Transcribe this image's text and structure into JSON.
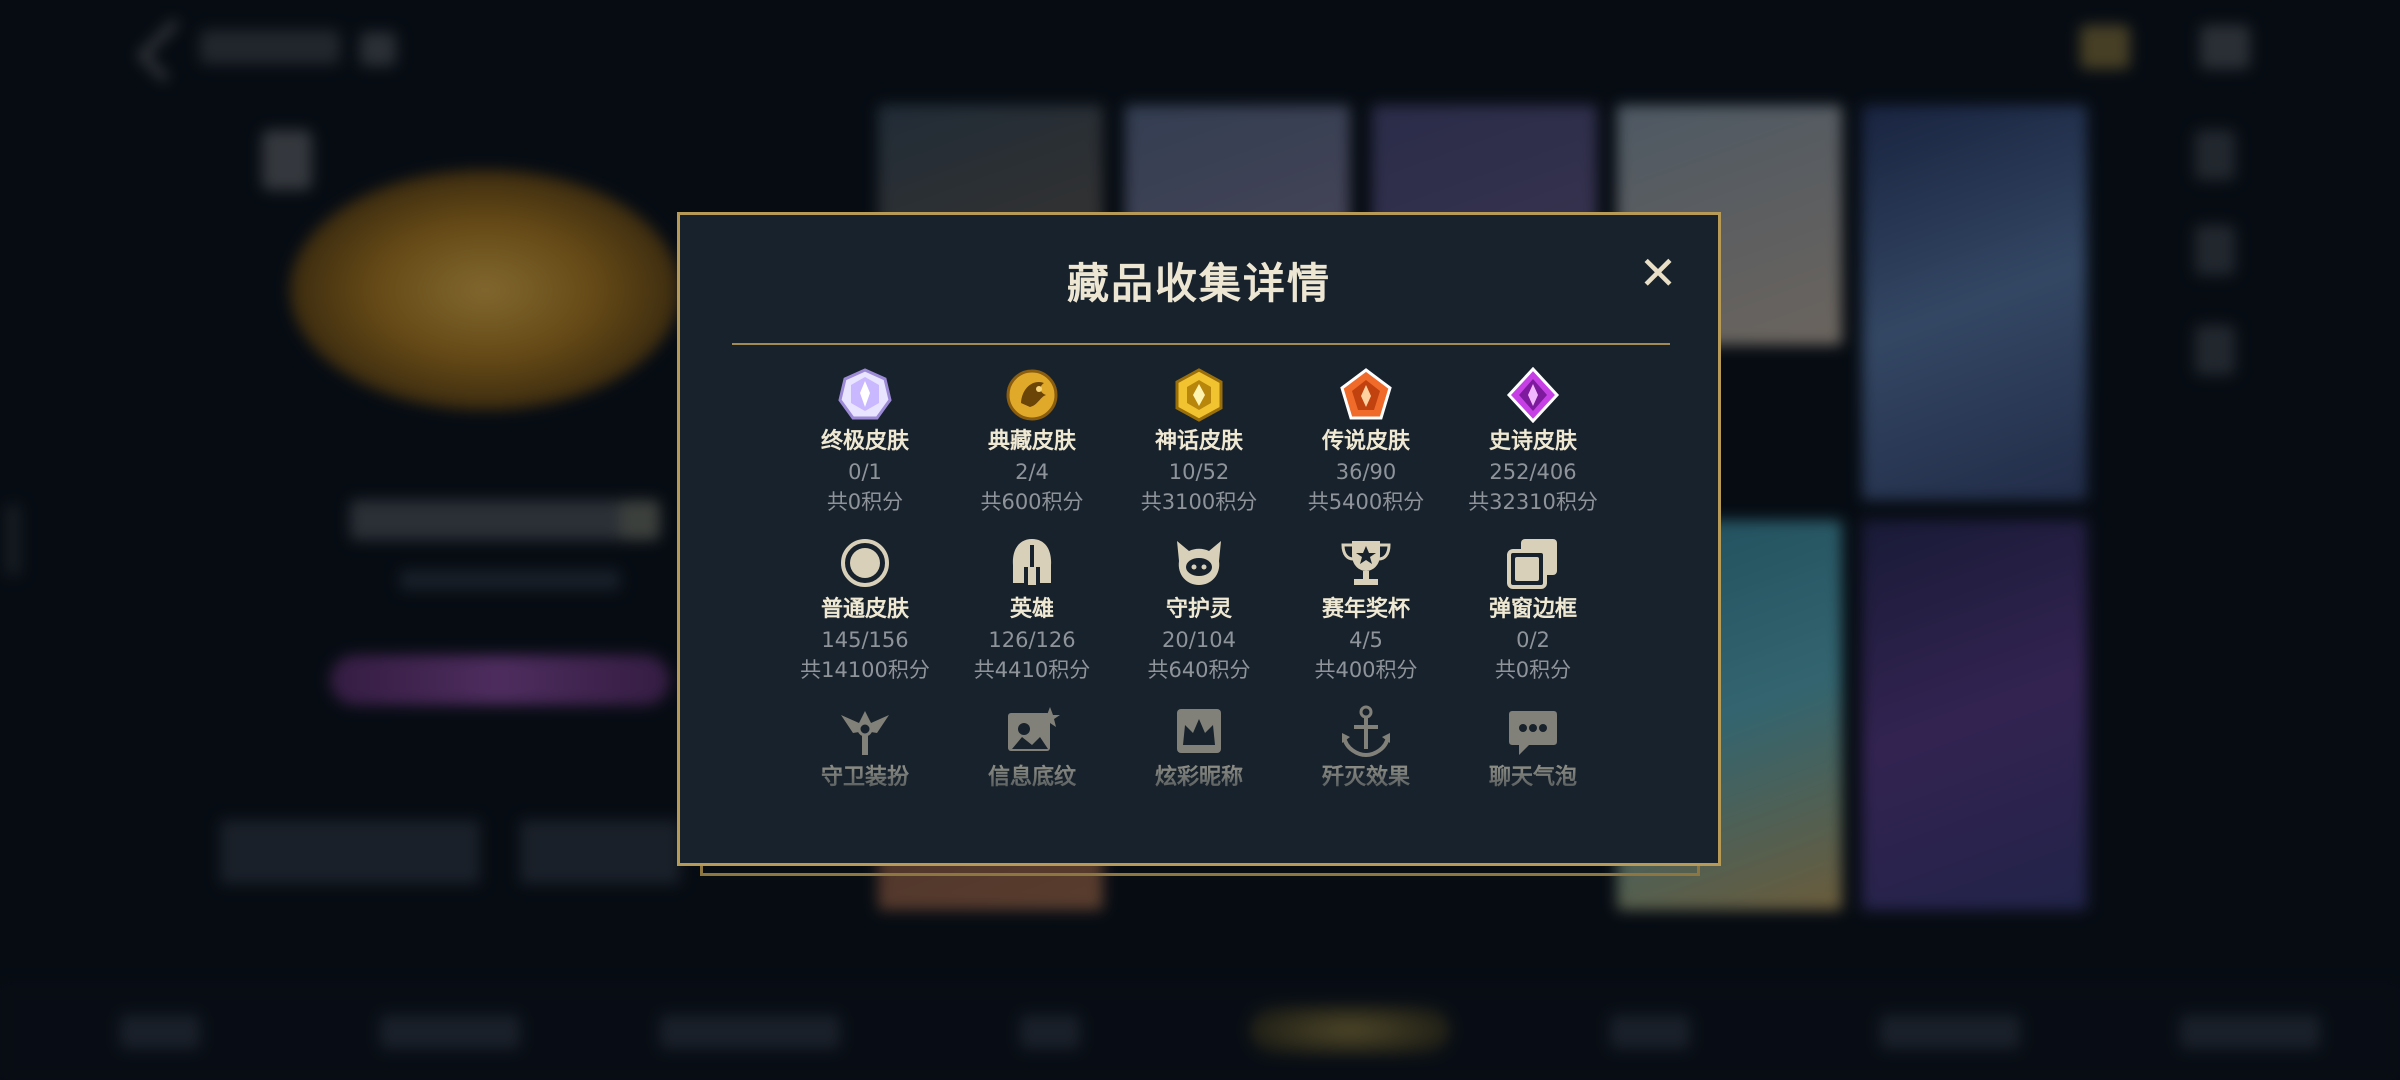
{
  "modal": {
    "title": "藏品收集详情",
    "close_glyph": "✕"
  },
  "collections": [
    {
      "label": "终极皮肤",
      "count": "0/1",
      "points": "共0积分",
      "icon": "ultimate-skin-icon",
      "color": "#c9b7ff"
    },
    {
      "label": "典藏皮肤",
      "count": "2/4",
      "points": "共600积分",
      "icon": "prestige-skin-icon",
      "color": "#e0a92a"
    },
    {
      "label": "神话皮肤",
      "count": "10/52",
      "points": "共3100积分",
      "icon": "mythic-skin-icon",
      "color": "#f2c330"
    },
    {
      "label": "传说皮肤",
      "count": "36/90",
      "points": "共5400积分",
      "icon": "legendary-skin-icon",
      "color": "#f06a2a"
    },
    {
      "label": "史诗皮肤",
      "count": "252/406",
      "points": "共32310积分",
      "icon": "epic-skin-icon",
      "color": "#c640e6"
    },
    {
      "label": "普通皮肤",
      "count": "145/156",
      "points": "共14100积分",
      "icon": "normal-skin-icon",
      "color": "#d8d0b8"
    },
    {
      "label": "英雄",
      "count": "126/126",
      "points": "共4410积分",
      "icon": "hero-helmet-icon",
      "color": "#d8d0b8"
    },
    {
      "label": "守护灵",
      "count": "20/104",
      "points": "共640积分",
      "icon": "guardian-spirit-icon",
      "color": "#d8d0b8"
    },
    {
      "label": "赛年奖杯",
      "count": "4/5",
      "points": "共400积分",
      "icon": "trophy-icon",
      "color": "#d8d0b8"
    },
    {
      "label": "弹窗边框",
      "count": "0/2",
      "points": "共0积分",
      "icon": "popup-frame-icon",
      "color": "#d8d0b8"
    },
    {
      "label": "守卫装扮",
      "icon": "ward-skin-icon",
      "color": "#d8d0b8"
    },
    {
      "label": "信息底纹",
      "icon": "profile-background-icon",
      "color": "#d8d0b8"
    },
    {
      "label": "炫彩昵称",
      "icon": "colorful-nickname-icon",
      "color": "#d8d0b8"
    },
    {
      "label": "歼灭效果",
      "icon": "elimination-effect-icon",
      "color": "#d8d0b8"
    },
    {
      "label": "聊天气泡",
      "icon": "chat-bubble-icon",
      "color": "#d8d0b8"
    }
  ],
  "colors": {
    "modal_bg": "#18222c",
    "modal_border": "#b79a55",
    "title": "#ece6d3",
    "muted": "#8f949a"
  }
}
